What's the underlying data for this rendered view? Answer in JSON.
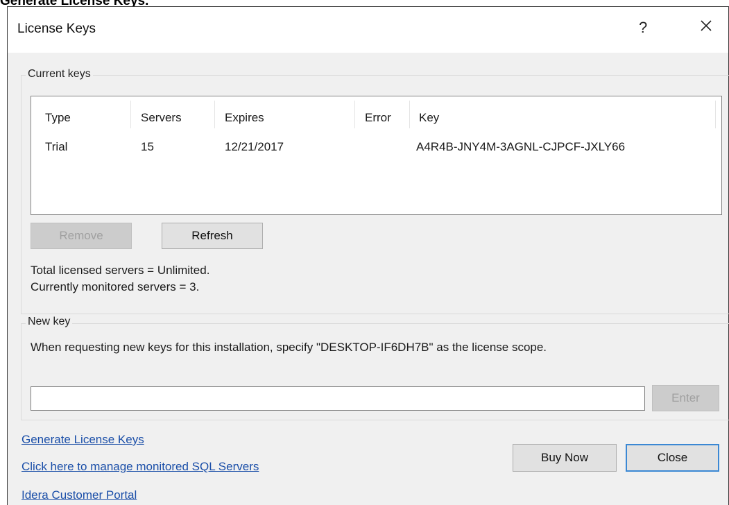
{
  "caption": "Generate License Keys.",
  "window": {
    "title": "License Keys",
    "help": "?"
  },
  "current_keys": {
    "label": "Current keys",
    "columns": [
      "Type",
      "Servers",
      "Expires",
      "Error",
      "Key"
    ],
    "rows": [
      {
        "type": "Trial",
        "servers": "15",
        "expires": "12/21/2017",
        "error": "",
        "key": "A4R4B-JNY4M-3AGNL-CJPCF-JXLY66"
      }
    ],
    "remove_label": "Remove",
    "refresh_label": "Refresh",
    "total_licensed": "Total licensed servers = Unlimited.",
    "currently_monitored": "Currently monitored servers = 3."
  },
  "new_key": {
    "label": "New key",
    "instructions": "When requesting new keys for this installation, specify \"DESKTOP-IF6DH7B\" as the license scope.",
    "input_value": "",
    "enter_label": "Enter"
  },
  "links": {
    "generate": "Generate License Keys",
    "manage": "Click here to manage monitored SQL Servers",
    "portal": "Idera Customer Portal"
  },
  "buttons": {
    "buy_now": "Buy Now",
    "close": "Close"
  },
  "colors": {
    "link": "#1a4ea8",
    "default_button_border": "#3b88d4",
    "dialog_background": "#f0f0f0"
  }
}
